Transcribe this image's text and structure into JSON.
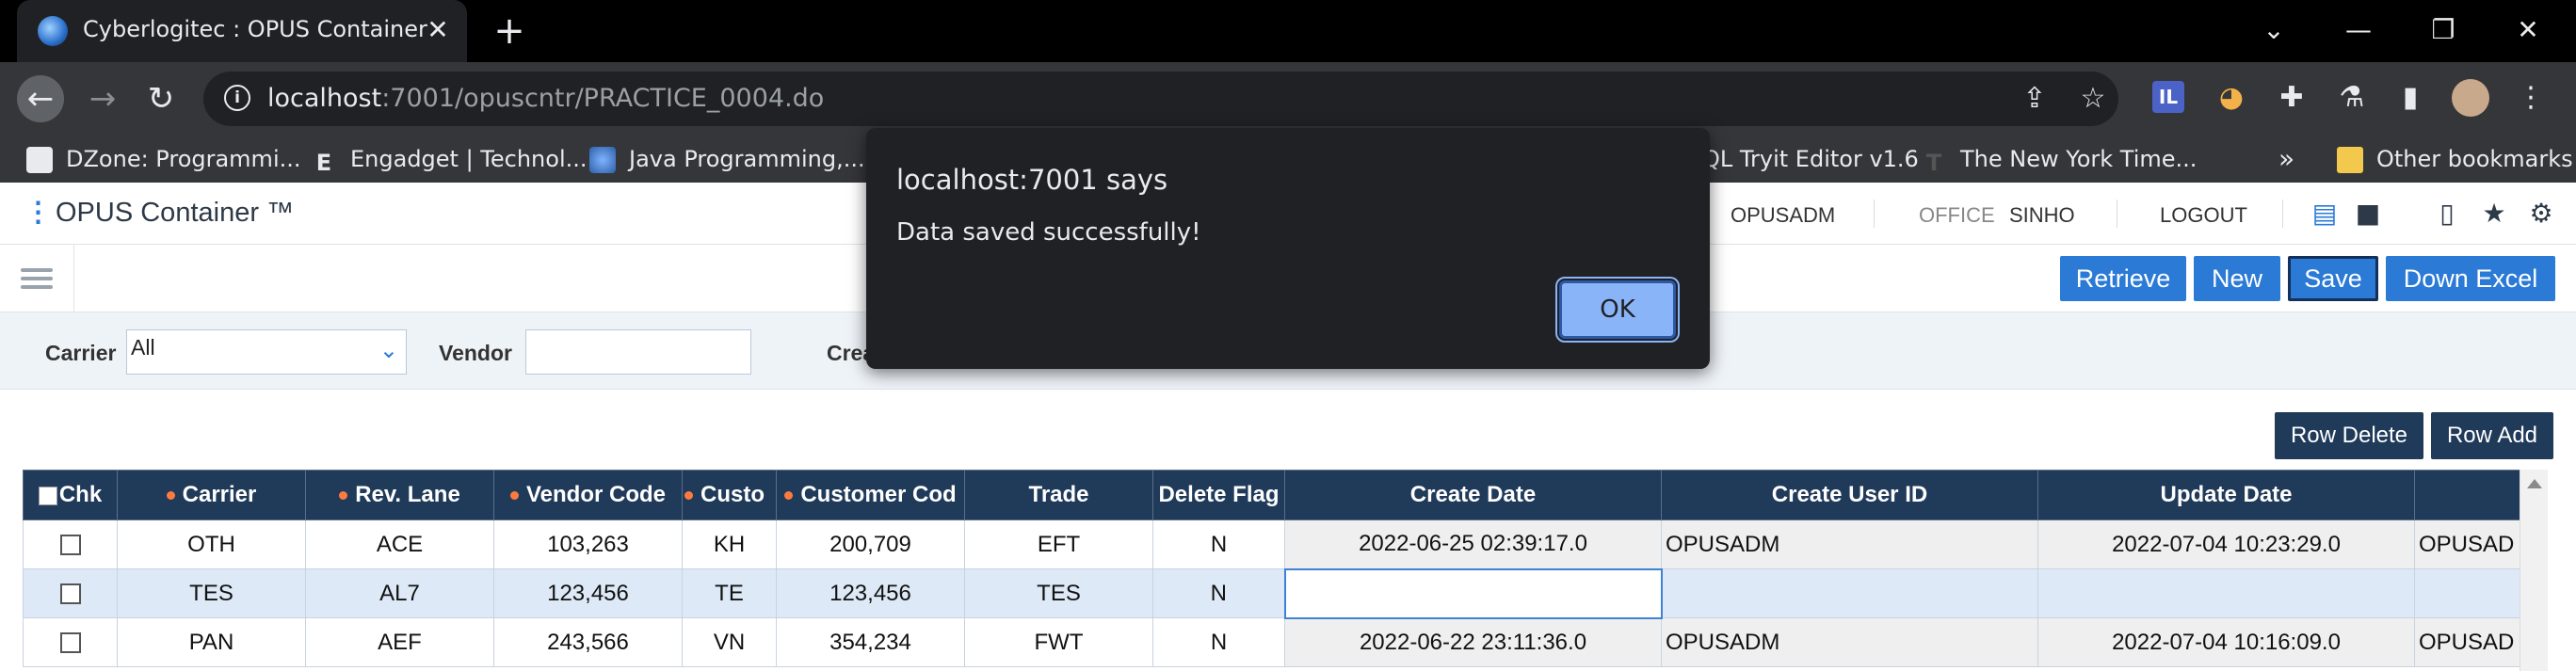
{
  "browser": {
    "tab_title": "Cyberlogitec : OPUS Container",
    "tab_close": "✕",
    "new_tab": "+",
    "window_controls": {
      "collapse": "⌄",
      "minimize": "—",
      "restore": "❐",
      "close": "✕"
    },
    "nav": {
      "back": "←",
      "forward": "→",
      "reload": "↻"
    },
    "url_host": "localhost",
    "url_rest": ":7001/opuscntr/PRACTICE_0004.do",
    "bookmarks": [
      {
        "label": "DZone: Programmi..."
      },
      {
        "label": "Engadget | Technol..."
      },
      {
        "label": "Java Programming,..."
      },
      {
        "label": "QL Tryit Editor v1.6"
      },
      {
        "label": "The New York Time..."
      }
    ],
    "bookmarks_overflow": "»",
    "other_bookmarks": "Other bookmarks"
  },
  "app": {
    "logo": "OPUS Container ™",
    "user": "OPUSADM",
    "office_label": "OFFICE",
    "office_value": "SINHO",
    "logout": "LOGOUT"
  },
  "actions": {
    "retrieve": "Retrieve",
    "new": "New",
    "save": "Save",
    "down_excel": "Down Excel"
  },
  "search": {
    "carrier_label": "Carrier",
    "carrier_value": "All",
    "vendor_label": "Vendor",
    "vendor_value": "",
    "create_label": "Crea"
  },
  "grid": {
    "row_delete": "Row Delete",
    "row_add": "Row Add",
    "columns": [
      "Chk",
      "Carrier",
      "Rev. Lane",
      "Vendor Code",
      "Custo",
      "Customer Cod",
      "Trade",
      "Delete Flag",
      "Create Date",
      "Create User ID",
      "Update Date",
      ""
    ],
    "rows": [
      {
        "carrier": "OTH",
        "rev_lane": "ACE",
        "vendor_code": "103,263",
        "cust": "KH",
        "customer_code": "200,709",
        "trade": "EFT",
        "delete_flag": "N",
        "create_date": "2022-06-25 02:39:17.0",
        "create_user": "OPUSADM",
        "update_date": "2022-07-04 10:23:29.0",
        "update_user": "OPUSAD"
      },
      {
        "carrier": "TES",
        "rev_lane": "AL7",
        "vendor_code": "123,456",
        "cust": "TE",
        "customer_code": "123,456",
        "trade": "TES",
        "delete_flag": "N",
        "create_date": "",
        "create_user": "",
        "update_date": "",
        "update_user": ""
      },
      {
        "carrier": "PAN",
        "rev_lane": "AEF",
        "vendor_code": "243,566",
        "cust": "VN",
        "customer_code": "354,234",
        "trade": "FWT",
        "delete_flag": "N",
        "create_date": "2022-06-22 23:11:36.0",
        "create_user": "OPUSADM",
        "update_date": "2022-07-04 10:16:09.0",
        "update_user": "OPUSAD"
      }
    ]
  },
  "dialog": {
    "title": "localhost:7001 says",
    "message": "Data saved successfully!",
    "ok": "OK"
  },
  "colors": {
    "accent": "#2a7ad6",
    "grid_header": "#203a5a",
    "required_dot": "#ff7a3d",
    "selected_row": "#dde9f7"
  }
}
